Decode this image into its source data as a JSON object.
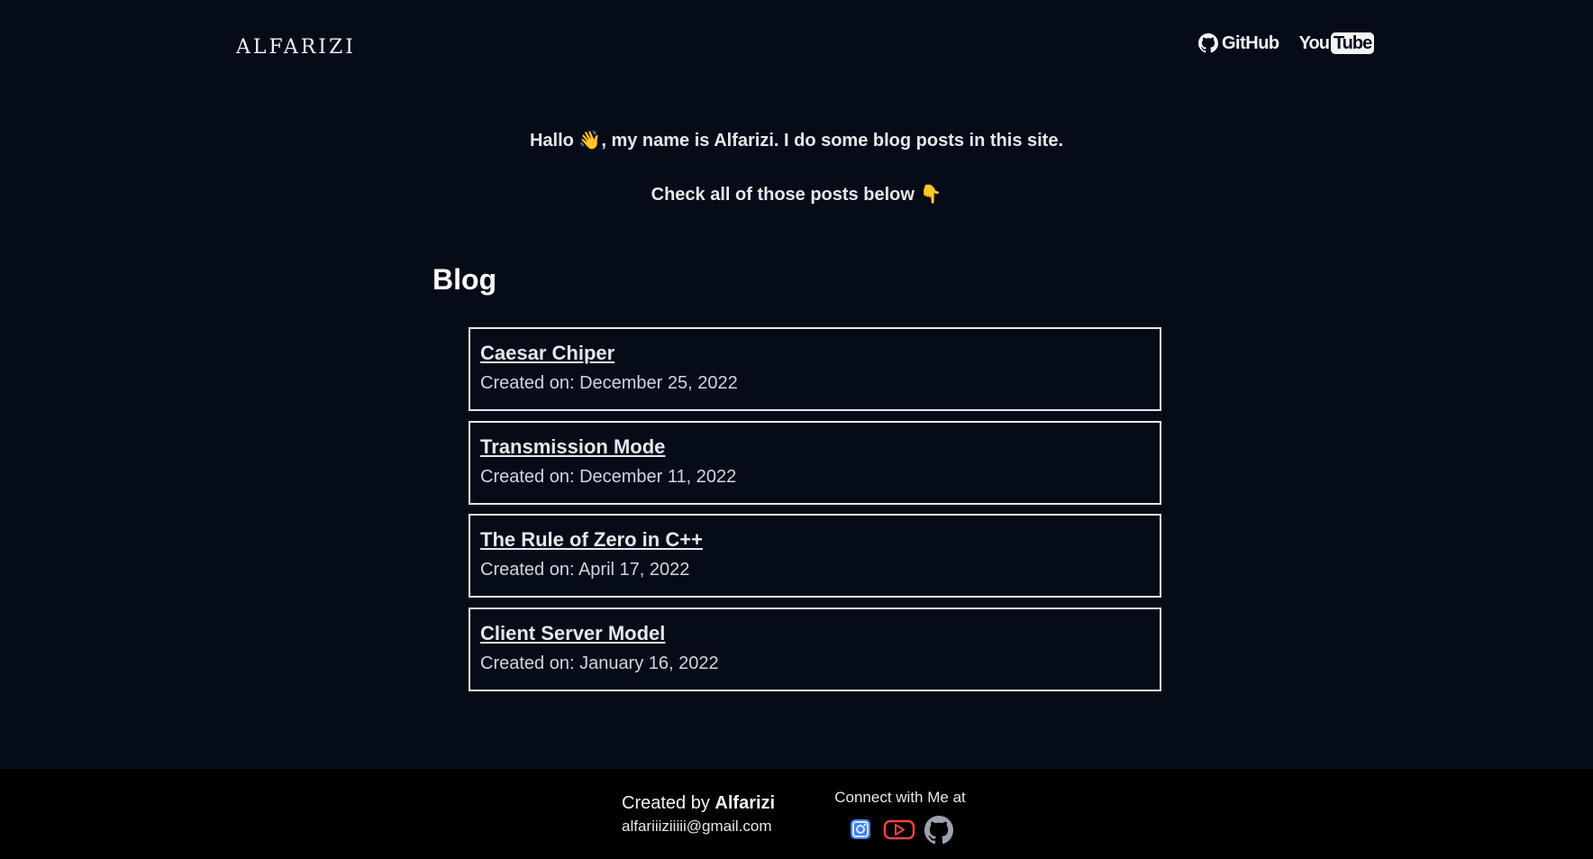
{
  "header": {
    "logo": "ALFARIZI",
    "nav": {
      "github_label": "GitHub",
      "youtube_you": "You",
      "youtube_tube": "Tube"
    }
  },
  "intro": {
    "line1": "Hallo 👋, my name is Alfarizi. I do some blog posts in this site.",
    "line2": "Check all of those posts below 👇"
  },
  "blog": {
    "heading": "Blog",
    "posts": [
      {
        "title": "Caesar Chiper",
        "date": "Created on: December 25, 2022"
      },
      {
        "title": "Transmission Mode",
        "date": "Created on: December 11, 2022"
      },
      {
        "title": "The Rule of Zero in C++",
        "date": "Created on: April 17, 2022"
      },
      {
        "title": "Client Server Model",
        "date": "Created on: January 16, 2022"
      }
    ]
  },
  "footer": {
    "created_by": "Created by",
    "author": "Alfarizi",
    "email": "alfariiiziiiii@gmail.com",
    "connect_text": "Connect with Me at",
    "socials": [
      "instagram-icon",
      "youtube-icon",
      "github-icon"
    ]
  },
  "colors": {
    "background": "#050b17",
    "footer_bg": "#000000",
    "instagram": "#3b82f6",
    "youtube": "#ef4444",
    "github": "#9ca3af"
  }
}
